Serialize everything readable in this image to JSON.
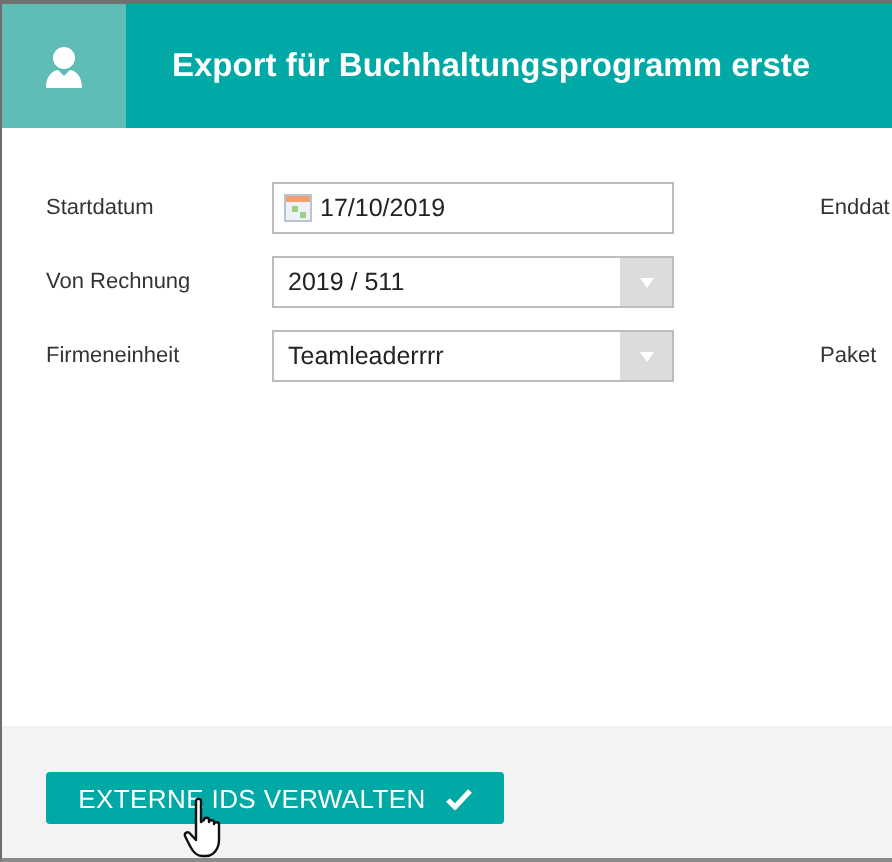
{
  "header": {
    "title": "Export für Buchhaltungsprogramm erste"
  },
  "fields": [
    {
      "label": "Startdatum",
      "kind": "date",
      "value": "17/10/2019",
      "side_label": "Enddat"
    },
    {
      "label": "Von Rechnung",
      "kind": "select",
      "value": "2019 / 511"
    },
    {
      "label": "Firmeneinheit",
      "kind": "select",
      "value": "Teamleaderrrr",
      "side_label": "Paket"
    }
  ],
  "footer": {
    "button": "EXTERNE IDS VERWALTEN"
  }
}
